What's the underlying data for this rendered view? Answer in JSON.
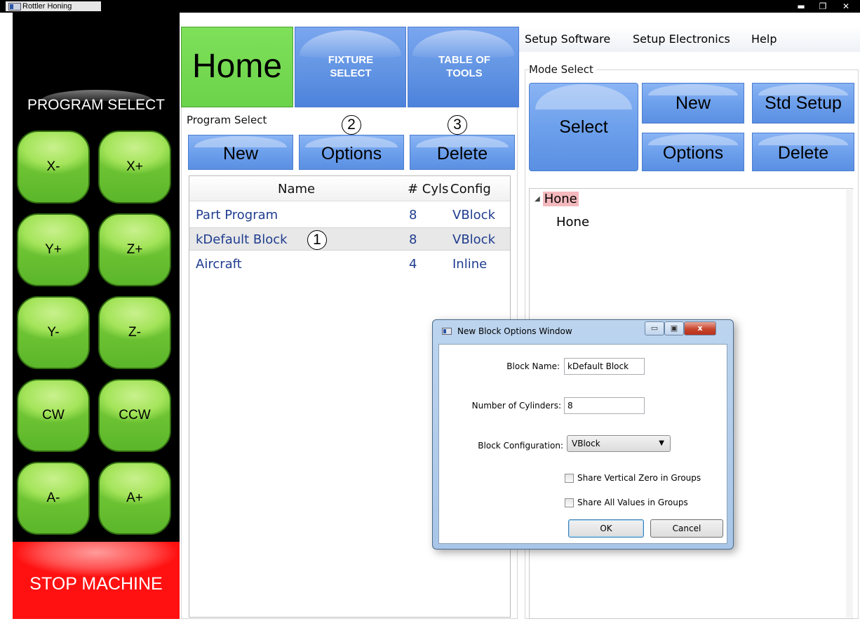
{
  "window": {
    "title": "Rottler Honing",
    "minimize": "▬",
    "maximize": "❐",
    "close": "✕"
  },
  "left_panel": {
    "title": "PROGRAM SELECT",
    "jog_buttons": [
      "X-",
      "X+",
      "Y+",
      "Z+",
      "Y-",
      "Z-",
      "CW",
      "CCW",
      "A-",
      "A+"
    ],
    "stop_label": "STOP MACHINE"
  },
  "tabs": {
    "home": "Home",
    "fixture": "FIXTURE SELECT",
    "tools": "TABLE OF TOOLS"
  },
  "program_select": {
    "group_label": "Program Select",
    "new_label": "New",
    "options_label": "Options",
    "delete_label": "Delete",
    "callouts": [
      "1",
      "2",
      "3"
    ],
    "columns": [
      "Name",
      "# Cyls",
      "Config"
    ],
    "rows": [
      {
        "name": "Part Program",
        "cyls": "8",
        "config": "VBlock"
      },
      {
        "name": "kDefault Block",
        "cyls": "8",
        "config": "VBlock"
      },
      {
        "name": "Aircraft",
        "cyls": "4",
        "config": "Inline"
      }
    ]
  },
  "menu": {
    "setup_software": "Setup Software",
    "setup_electronics": "Setup Electronics",
    "help": "Help"
  },
  "mode_select": {
    "group_label": "Mode Select",
    "select_label": "Select",
    "new_label": "New",
    "std_setup_label": "Std Setup",
    "options_label": "Options",
    "delete_label": "Delete",
    "tree": {
      "root": "Hone",
      "child": "Hone"
    }
  },
  "dialog": {
    "title": "New Block Options Window",
    "block_name_label": "Block Name:",
    "block_name_value": "kDefault Block",
    "cylinders_label": "Number of Cylinders:",
    "cylinders_value": "8",
    "config_label": "Block Configuration:",
    "config_value": "VBlock",
    "share_vertical_label": "Share Vertical Zero in Groups",
    "share_all_label": "Share All Values in Groups",
    "share_vertical_checked": false,
    "share_all_checked": false,
    "ok_label": "OK",
    "cancel_label": "Cancel",
    "close_glyph": "x",
    "min_glyph": "▭",
    "max_glyph": "▣"
  }
}
